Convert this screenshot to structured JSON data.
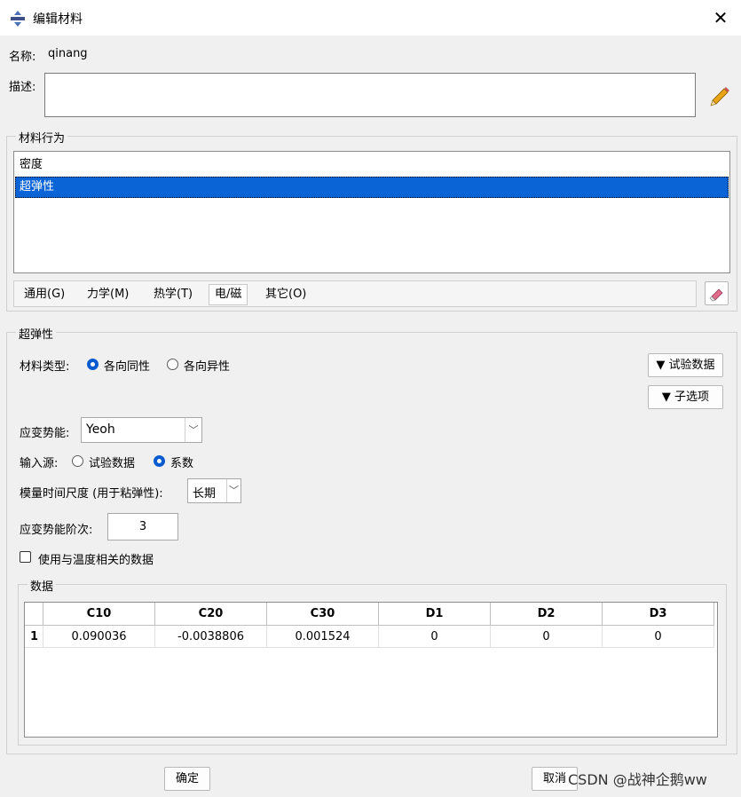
{
  "window": {
    "title": "编辑材料",
    "close_glyph": "✕"
  },
  "name_field": {
    "label": "名称:",
    "value": "qinang"
  },
  "description": {
    "label": "描述:",
    "value": ""
  },
  "behaviors_group": {
    "title": "材料行为",
    "items": [
      {
        "label": "密度",
        "selected": false
      },
      {
        "label": "超弹性",
        "selected": true
      }
    ]
  },
  "menu_tabs": [
    {
      "label": "通用(G)"
    },
    {
      "label": "力学(M)"
    },
    {
      "label": "热学(T)"
    },
    {
      "label": "电/磁"
    },
    {
      "label": "其它(O)"
    }
  ],
  "hyperelastic": {
    "title": "超弹性",
    "material_type": {
      "label": "材料类型:",
      "options": [
        "各向同性",
        "各向异性"
      ],
      "selected": "各向同性"
    },
    "test_data_button": "▼ 试验数据",
    "suboptions_button": "▼ 子选项",
    "strain_energy": {
      "label": "应变势能:",
      "value": "Yeoh"
    },
    "input_source": {
      "label": "输入源:",
      "options": [
        "试验数据",
        "系数"
      ],
      "selected": "系数"
    },
    "moduli_time_scale": {
      "label": "模量时间尺度 (用于粘弹性):",
      "value": "长期"
    },
    "strain_energy_order": {
      "label": "应变势能阶次:",
      "value": "3"
    },
    "temperature_dependent": {
      "label": "使用与温度相关的数据",
      "checked": false
    },
    "data_group": {
      "title": "数据",
      "columns": [
        "C10",
        "C20",
        "C30",
        "D1",
        "D2",
        "D3"
      ],
      "rows": [
        {
          "index": "1",
          "values": [
            "0.090036",
            "-0.0038806",
            "0.001524",
            "0",
            "0",
            "0"
          ]
        }
      ]
    }
  },
  "footer": {
    "ok_label": "确定",
    "cancel_label": "取消"
  },
  "watermark": "CSDN @战神企鹅ww",
  "colors": {
    "selection": "#0a64d6",
    "radio_accent": "#0a5bd0",
    "pencil": "#e8a317"
  }
}
